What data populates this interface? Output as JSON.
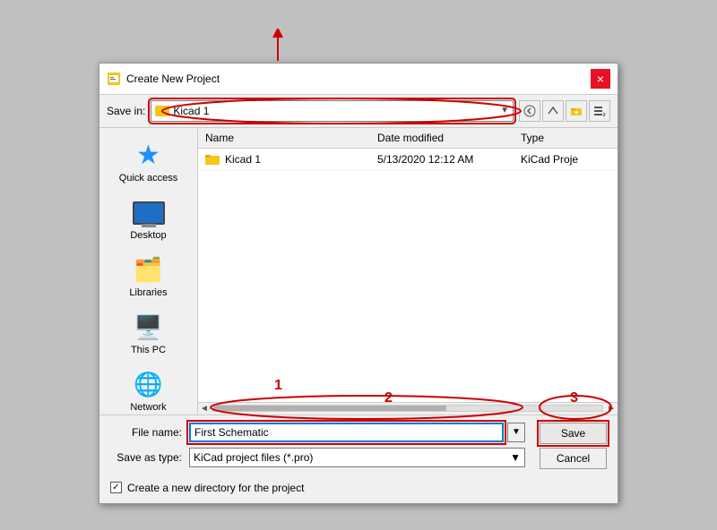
{
  "dialog": {
    "title": "Create New Project",
    "close_label": "×"
  },
  "toolbar": {
    "save_in_label": "Save in:",
    "current_folder": "Kicad 1",
    "back_btn": "◄",
    "up_btn": "▲",
    "new_folder_btn": "📁",
    "menu_btn": "▼"
  },
  "file_panel": {
    "col_name": "Name",
    "col_date": "Date modified",
    "col_type": "Type",
    "files": [
      {
        "name": "Kicad 1",
        "date": "5/13/2020 12:12 AM",
        "type": "KiCad Proje"
      }
    ]
  },
  "bottom_form": {
    "file_name_label": "File name:",
    "file_name_value": "First Schematic",
    "save_type_label": "Save as type:",
    "save_type_value": "KiCad project files (*.pro)",
    "save_btn_label": "Save",
    "cancel_btn_label": "Cancel"
  },
  "checkbox": {
    "label": "Create a new directory for the project",
    "checked": true
  },
  "sidebar": {
    "items": [
      {
        "id": "quick-access",
        "label": "Quick access"
      },
      {
        "id": "desktop",
        "label": "Desktop"
      },
      {
        "id": "libraries",
        "label": "Libraries"
      },
      {
        "id": "this-pc",
        "label": "This PC"
      },
      {
        "id": "network",
        "label": "Network"
      }
    ]
  },
  "annotations": {
    "num1": "1",
    "num2": "2",
    "num3": "3"
  }
}
